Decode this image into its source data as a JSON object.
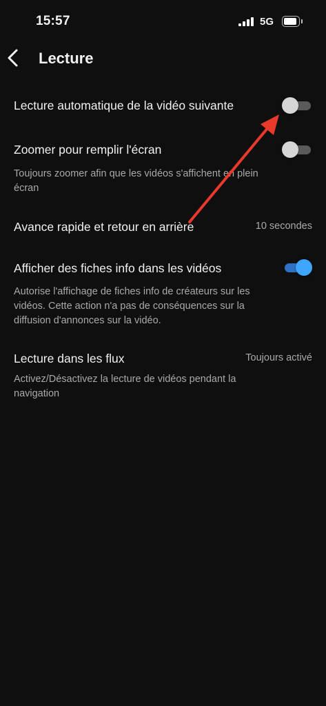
{
  "status_bar": {
    "time": "15:57",
    "network": "5G"
  },
  "header": {
    "title": "Lecture"
  },
  "settings": {
    "autoplay": {
      "label": "Lecture automatique de la vidéo suivante",
      "enabled": false
    },
    "zoom": {
      "label": "Zoomer pour remplir l'écran",
      "enabled": false,
      "description": "Toujours zoomer afin que les vidéos s'affichent en plein écran"
    },
    "seek": {
      "label": "Avance rapide et retour en arrière",
      "value": "10 secondes"
    },
    "info_cards": {
      "label": "Afficher des fiches info dans les vidéos",
      "enabled": true,
      "description": "Autorise l'affichage de fiches info de créateurs sur les vidéos. Cette action n'a pas de conséquences sur la diffusion d'annonces sur la vidéo."
    },
    "feed_playback": {
      "label": "Lecture dans les flux",
      "value": "Toujours activé",
      "description": "Activez/Désactivez la lecture de vidéos pendant la navigation"
    }
  },
  "colors": {
    "background": "#0f0f0f",
    "accent": "#3ea6ff",
    "annotation": "#e8392b"
  }
}
